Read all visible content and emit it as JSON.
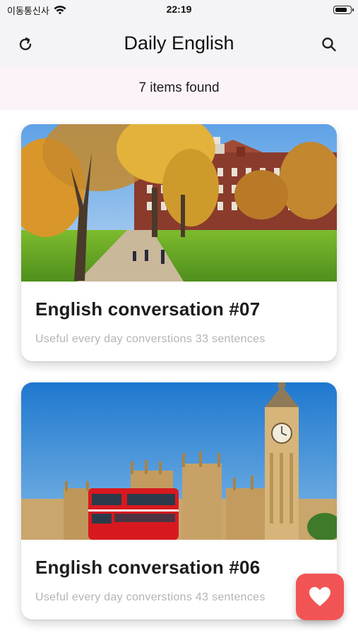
{
  "status_bar": {
    "carrier": "이동통신사",
    "time": "22:19",
    "battery_level": 0.8
  },
  "nav": {
    "title": "Daily English",
    "refresh_icon": "refresh-icon",
    "search_icon": "search-icon"
  },
  "results": {
    "count_text": "7 items found"
  },
  "cards": [
    {
      "title": "English conversation #07",
      "subtitle": "Useful every day converstions 33 sentences",
      "image": "university-campus-autumn"
    },
    {
      "title": "English conversation #06",
      "subtitle": "Useful every day converstions 43 sentences",
      "image": "london-big-ben-red-bus"
    }
  ],
  "fab": {
    "icon": "heart-icon",
    "color": "#f25455"
  },
  "colors": {
    "accent": "#f25455",
    "results_bg": "#fbf3f7",
    "nav_bg": "#f4f4f6",
    "subtitle_gray": "#b4b4b8"
  }
}
